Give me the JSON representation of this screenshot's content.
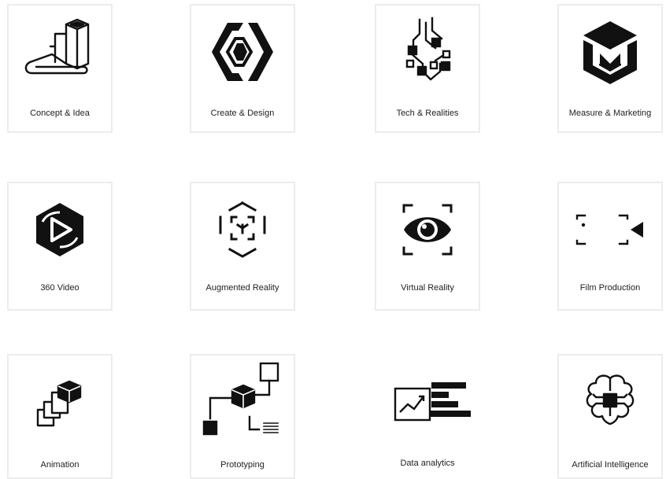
{
  "services": [
    {
      "label": "Concept & Idea",
      "icon": "blueprint-icon"
    },
    {
      "label": "Create & Design",
      "icon": "hexagon-logo-icon"
    },
    {
      "label": "Tech & Realities",
      "icon": "circuit-icon"
    },
    {
      "label": "Measure & Marketing",
      "icon": "cube-m-icon"
    },
    {
      "label": "360 Video",
      "icon": "360-video-icon"
    },
    {
      "label": "Augmented Reality",
      "icon": "ar-cube-icon"
    },
    {
      "label": "Virtual Reality",
      "icon": "vr-eye-icon"
    },
    {
      "label": "Film Production",
      "icon": "film-camera-icon"
    },
    {
      "label": "Animation",
      "icon": "animation-layers-icon"
    },
    {
      "label": "Prototyping",
      "icon": "prototype-flow-icon"
    },
    {
      "label": "Data analytics",
      "icon": "data-chart-icon"
    },
    {
      "label": "Artificial Intelligence",
      "icon": "ai-brain-icon"
    }
  ]
}
